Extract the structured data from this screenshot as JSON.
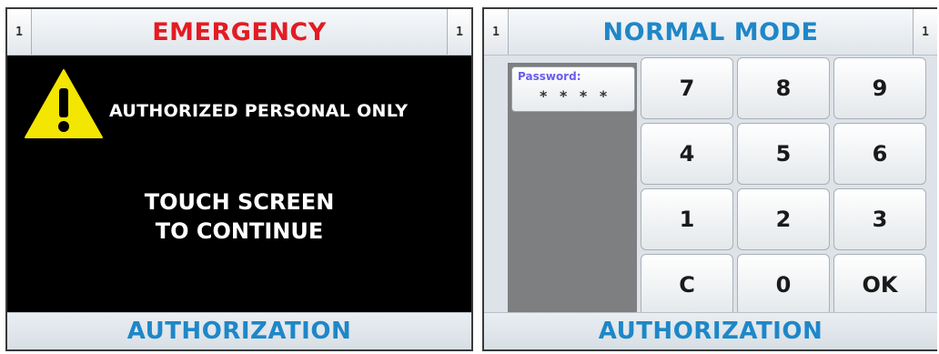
{
  "left_screen": {
    "corner_left": "1",
    "corner_right": "1",
    "title": "EMERGENCY",
    "title_color": "#e31b23",
    "warning_icon": "warning-triangle-icon",
    "warning_text": "AUTHORIZED PERSONAL ONLY",
    "prompt_line1": "TOUCH SCREEN",
    "prompt_line2": "TO CONTINUE",
    "bottom_label": "AUTHORIZATION"
  },
  "right_screen": {
    "corner_left": "1",
    "corner_right": "1",
    "title": "NORMAL MODE",
    "title_color": "#1e87c8",
    "password_label": "Password:",
    "password_value": "* * * *",
    "keys": [
      "7",
      "8",
      "9",
      "4",
      "5",
      "6",
      "1",
      "2",
      "3",
      "C",
      "0",
      "OK"
    ],
    "bottom_label": "AUTHORIZATION"
  }
}
